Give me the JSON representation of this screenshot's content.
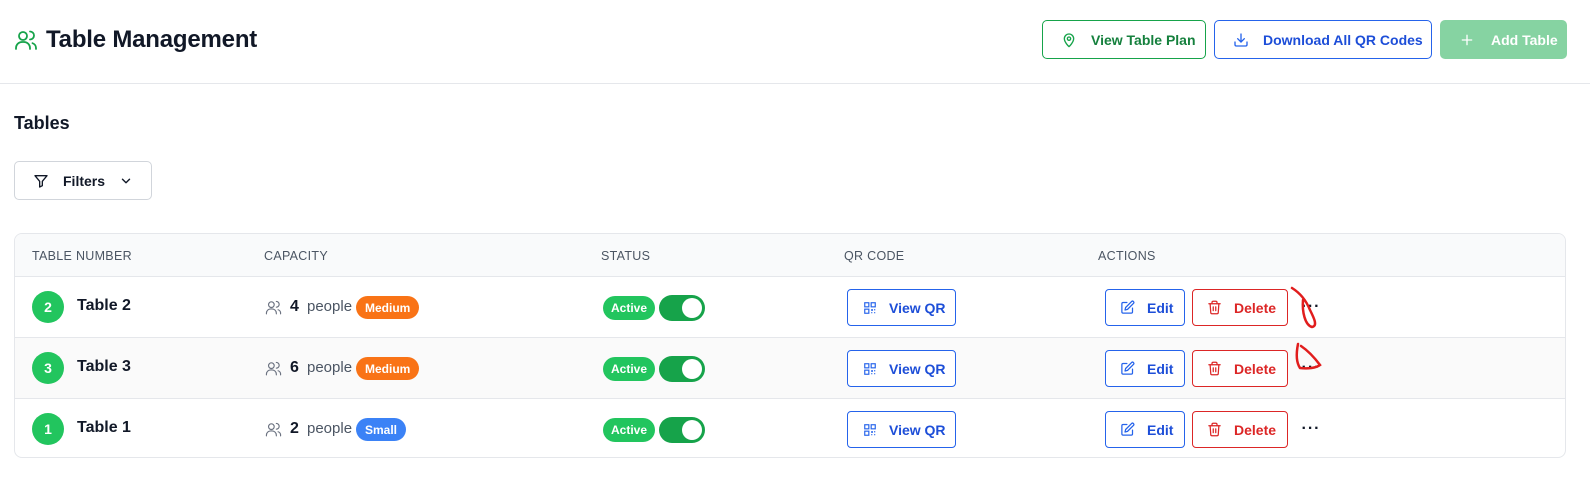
{
  "header": {
    "title": "Table Management",
    "title_icon": "users-icon",
    "buttons": {
      "view_plan": {
        "label": "View Table Plan",
        "icon": "map-pin-icon"
      },
      "download_qr": {
        "label": "Download All QR Codes",
        "icon": "download-icon"
      },
      "add_table": {
        "label": "Add Table",
        "icon": "plus-icon",
        "disabled": true
      }
    }
  },
  "section": {
    "title": "Tables"
  },
  "filters": {
    "label": "Filters",
    "icon": "filter-icon"
  },
  "table": {
    "columns": [
      "TABLE NUMBER",
      "CAPACITY",
      "STATUS",
      "QR CODE",
      "ACTIONS"
    ],
    "rows": [
      {
        "number": "2",
        "name": "Table 2",
        "capacity": "4",
        "unit": "people",
        "size": "Medium",
        "size_color": "#f97316",
        "status": "Active",
        "active": true,
        "qr_label": "View QR",
        "edit_label": "Edit",
        "delete_label": "Delete"
      },
      {
        "number": "3",
        "name": "Table 3",
        "capacity": "6",
        "unit": "people",
        "size": "Medium",
        "size_color": "#f97316",
        "status": "Active",
        "active": true,
        "qr_label": "View QR",
        "edit_label": "Edit",
        "delete_label": "Delete"
      },
      {
        "number": "1",
        "name": "Table 1",
        "capacity": "2",
        "unit": "people",
        "size": "Small",
        "size_color": "#3b82f6",
        "status": "Active",
        "active": true,
        "qr_label": "View QR",
        "edit_label": "Edit",
        "delete_label": "Delete"
      }
    ]
  },
  "colors": {
    "primary_green": "#16a34a",
    "primary_blue": "#2563eb",
    "danger_red": "#dc2626",
    "annotation_red": "#e11d1d"
  }
}
